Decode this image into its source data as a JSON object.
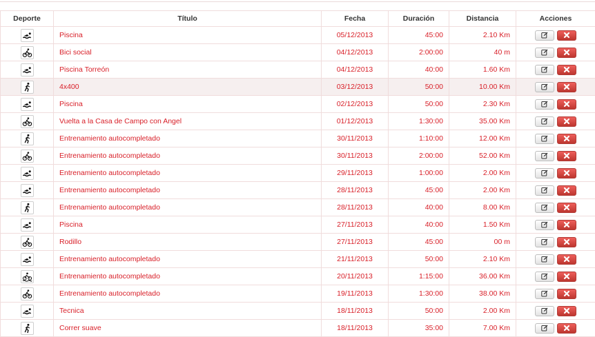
{
  "table": {
    "headers": {
      "sport": "Deporte",
      "title": "Título",
      "date": "Fecha",
      "duration": "Duración",
      "distance": "Distancia",
      "actions": "Acciones"
    },
    "rows": [
      {
        "sport": "swim",
        "title": "Piscina",
        "date": "05/12/2013",
        "duration": "45:00",
        "distance": "2.10 Km"
      },
      {
        "sport": "bike",
        "title": "Bici social",
        "date": "04/12/2013",
        "duration": "2:00:00",
        "distance": "40 m"
      },
      {
        "sport": "swim",
        "title": "Piscina Torreón",
        "date": "04/12/2013",
        "duration": "40:00",
        "distance": "1.60 Km"
      },
      {
        "sport": "run",
        "title": "4x400",
        "date": "03/12/2013",
        "duration": "50:00",
        "distance": "10.00 Km"
      },
      {
        "sport": "swim",
        "title": "Piscina",
        "date": "02/12/2013",
        "duration": "50:00",
        "distance": "2.30 Km"
      },
      {
        "sport": "bike",
        "title": "Vuelta a la Casa de Campo con Angel",
        "date": "01/12/2013",
        "duration": "1:30:00",
        "distance": "35.00 Km"
      },
      {
        "sport": "run",
        "title": "Entrenamiento autocompletado",
        "date": "30/11/2013",
        "duration": "1:10:00",
        "distance": "12.00 Km"
      },
      {
        "sport": "bike",
        "title": "Entrenamiento autocompletado",
        "date": "30/11/2013",
        "duration": "2:00:00",
        "distance": "52.00 Km"
      },
      {
        "sport": "swim",
        "title": "Entrenamiento autocompletado",
        "date": "29/11/2013",
        "duration": "1:00:00",
        "distance": "2.00 Km"
      },
      {
        "sport": "swim",
        "title": "Entrenamiento autocompletado",
        "date": "28/11/2013",
        "duration": "45:00",
        "distance": "2.00 Km"
      },
      {
        "sport": "run",
        "title": "Entrenamiento autocompletado",
        "date": "28/11/2013",
        "duration": "40:00",
        "distance": "8.00 Km"
      },
      {
        "sport": "swim",
        "title": "Piscina",
        "date": "27/11/2013",
        "duration": "40:00",
        "distance": "1.50 Km"
      },
      {
        "sport": "bike",
        "title": "Rodillo",
        "date": "27/11/2013",
        "duration": "45:00",
        "distance": "00 m"
      },
      {
        "sport": "swim",
        "title": "Entrenamiento autocompletado",
        "date": "21/11/2013",
        "duration": "50:00",
        "distance": "2.10 Km"
      },
      {
        "sport": "triathlon",
        "title": "Entrenamiento autocompletado",
        "date": "20/11/2013",
        "duration": "1:15:00",
        "distance": "36.00 Km"
      },
      {
        "sport": "bike",
        "title": "Entrenamiento autocompletado",
        "date": "19/11/2013",
        "duration": "1:30:00",
        "distance": "38.00 Km"
      },
      {
        "sport": "swim",
        "title": "Tecnica",
        "date": "18/11/2013",
        "duration": "50:00",
        "distance": "2.00 Km"
      },
      {
        "sport": "run",
        "title": "Correr suave",
        "date": "18/11/2013",
        "duration": "35:00",
        "distance": "7.00 Km"
      }
    ],
    "highlighted_row": 3
  },
  "icons": {
    "swim": "swimmer-icon",
    "bike": "cyclist-icon",
    "run": "runner-icon",
    "triathlon": "triathlon-icon",
    "edit": "edit-icon",
    "delete": "close-icon"
  },
  "colors": {
    "link_text": "#d81e27",
    "border": "#f0dcdc",
    "highlight_row": "#f6efef",
    "delete_button": "#da4f49"
  }
}
